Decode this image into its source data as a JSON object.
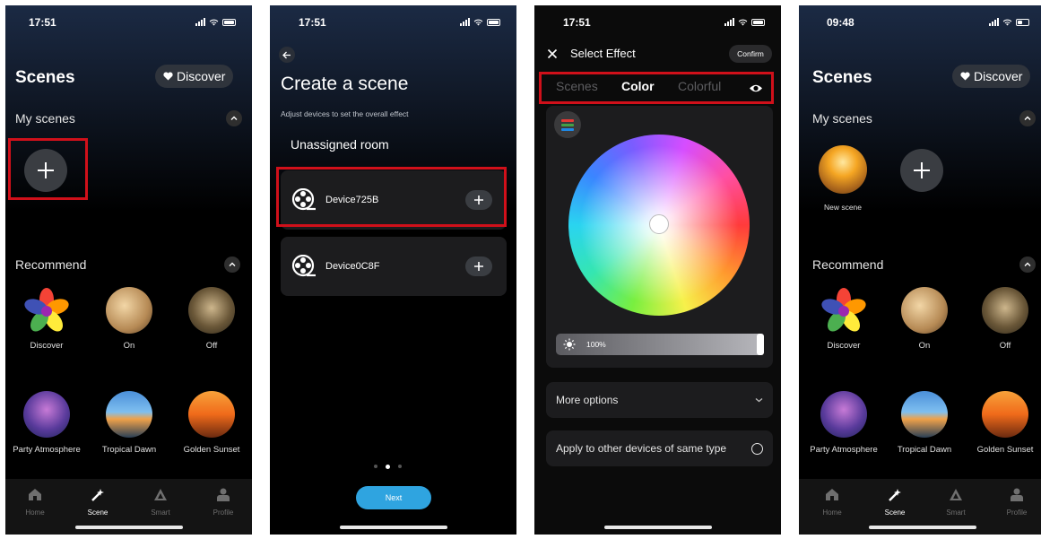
{
  "screen1": {
    "time": "17:51",
    "title": "Scenes",
    "discover_label": "Discover",
    "my_scenes_label": "My scenes",
    "recommend_label": "Recommend",
    "recommend": [
      "Discover",
      "On",
      "Off",
      "Party Atmosphere",
      "Tropical Dawn",
      "Golden Sunset"
    ],
    "tabs": [
      "Home",
      "Scene",
      "Smart",
      "Profile"
    ]
  },
  "screen2": {
    "time": "17:51",
    "title": "Create a scene",
    "subtitle": "Adjust devices to set the overall effect",
    "room_label": "Unassigned room",
    "devices": [
      "Device725B",
      "Device0C8F"
    ],
    "next_label": "Next",
    "page_index": 2,
    "page_count": 3
  },
  "screen3": {
    "time": "17:51",
    "title": "Select Effect",
    "confirm_label": "Confirm",
    "segments": [
      "Scenes",
      "Color",
      "Colorful"
    ],
    "active_segment": "Color",
    "brightness": "100%",
    "brightness_value": 100,
    "more_options_label": "More options",
    "apply_label": "Apply to other devices of same type"
  },
  "screen4": {
    "time": "09:48",
    "title": "Scenes",
    "discover_label": "Discover",
    "my_scenes_label": "My scenes",
    "new_scene_label": "New scene",
    "recommend_label": "Recommend",
    "recommend": [
      "Discover",
      "On",
      "Off",
      "Party Atmosphere",
      "Tropical Dawn",
      "Golden Sunset"
    ],
    "tabs": [
      "Home",
      "Scene",
      "Smart",
      "Profile"
    ]
  },
  "colors": {
    "highlight_red": "#d0101a",
    "accent_blue": "#2fa4e0",
    "card_bg": "#1c1c1e"
  }
}
